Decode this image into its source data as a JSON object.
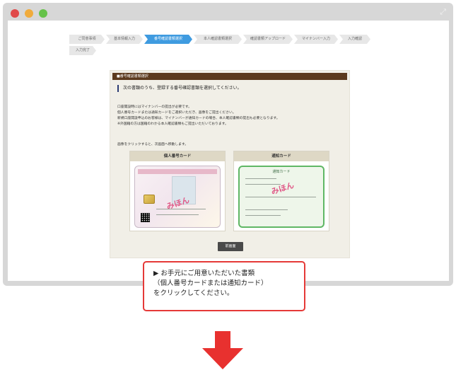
{
  "window": {
    "controls": [
      "close",
      "minimize",
      "maximize"
    ],
    "control_colors": [
      "#e04a4a",
      "#f0ab3c",
      "#66c24a"
    ],
    "expand_icon": "expand-icon"
  },
  "steps": [
    {
      "label": "ご同意事項",
      "active": false
    },
    {
      "label": "基本情報入力",
      "active": false
    },
    {
      "label": "番号確認書類選択",
      "active": true
    },
    {
      "label": "本人確認書類選択",
      "active": false
    },
    {
      "label": "確認書類アップロード",
      "active": false
    },
    {
      "label": "マイナンバー入力",
      "active": false
    },
    {
      "label": "入力確認",
      "active": false
    },
    {
      "label": "入力完了",
      "active": false
    }
  ],
  "panel": {
    "header": "■番号確認書類選択",
    "instruction": "次の書類のうち、登録する番号確認書類を選択してください。",
    "body_lines": [
      "口座開設時にはマイナンバーの提出が必要です。",
      "個人番号カードまたは通知カードをご選択いただき、画像をご提出ください。",
      "新規口座開設申込のお客様は、マイナンバーが通知カードの場合、本人確認書類の提出も必要となります。",
      "※外国籍の方は国籍のわかる本人確認書類もご提出いただいております。"
    ],
    "click_note": "画像をクリックすると、次画面へ移動します。",
    "cards": [
      {
        "title": "個人番号カード",
        "watermark": "みほん"
      },
      {
        "title": "通知カード",
        "watermark": "みほん",
        "card_header": "通知カード"
      }
    ],
    "back_button": "前画面"
  },
  "callout": {
    "lines": [
      "▶ お手元にご用意いただいた書類",
      "（個人番号カードまたは通知カード）",
      "をクリックしてください。"
    ]
  },
  "colors": {
    "accent_step": "#3f9be0",
    "panel_header": "#5c3a1e",
    "callout_border": "#e53937",
    "arrow": "#e8312f"
  }
}
